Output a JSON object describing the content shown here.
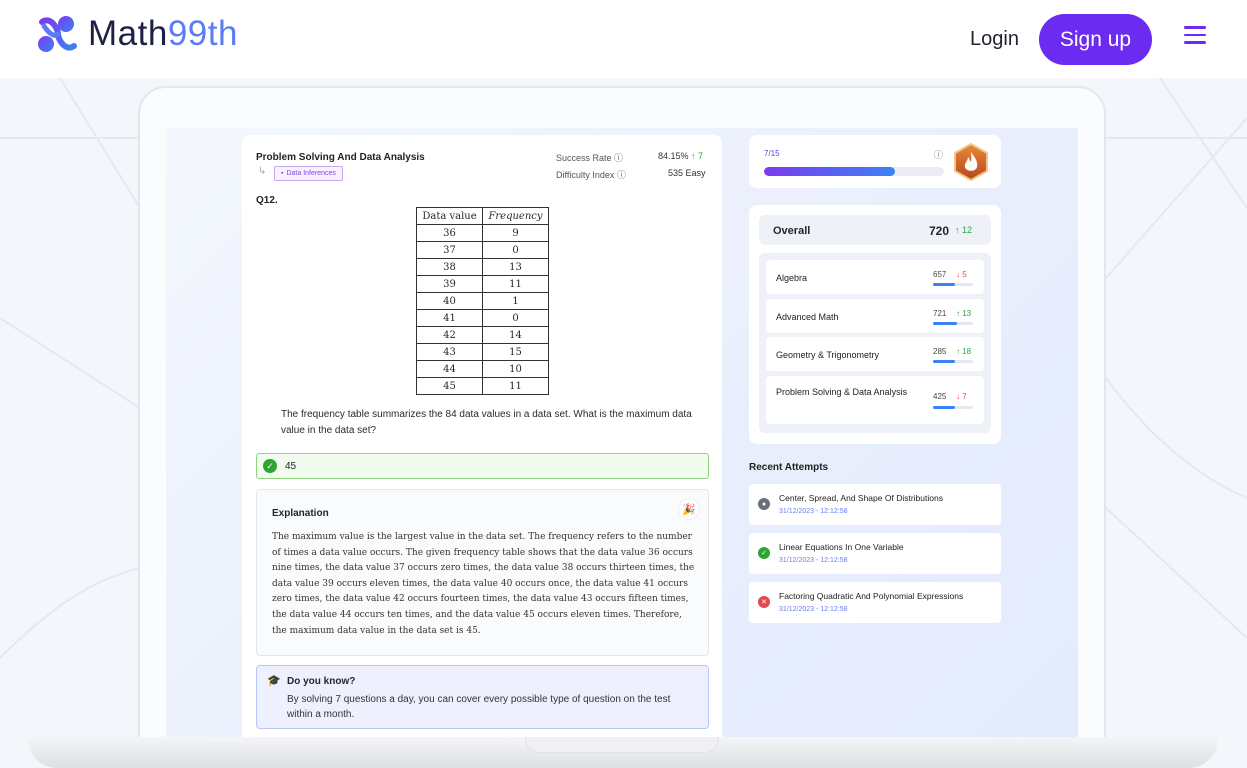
{
  "header": {
    "logo_text_main": "Math",
    "logo_text_accent": "99th",
    "login_label": "Login",
    "signup_label": "Sign up",
    "brand_color": "#6b2bf0"
  },
  "question": {
    "subject": "Problem Solving And Data Analysis",
    "tag": "Data Inferences",
    "success_rate_label": "Success Rate",
    "success_rate_value": "84.15%",
    "success_rate_delta": "↑ 7",
    "difficulty_label": "Difficulty Index",
    "difficulty_value": "535 Easy",
    "number": "Q12.",
    "table_headers": [
      "Data value",
      "Frequency"
    ],
    "table_rows": [
      [
        "36",
        "9"
      ],
      [
        "37",
        "0"
      ],
      [
        "38",
        "13"
      ],
      [
        "39",
        "11"
      ],
      [
        "40",
        "1"
      ],
      [
        "41",
        "0"
      ],
      [
        "42",
        "14"
      ],
      [
        "43",
        "15"
      ],
      [
        "44",
        "10"
      ],
      [
        "45",
        "11"
      ]
    ],
    "text": "The frequency table summarizes the 84 data values in a data set. What is the maximum data value in the data set?",
    "answer": "45",
    "explanation_title": "Explanation",
    "explanation_body": "The maximum value is the largest value in the data set. The frequency refers to the number of times a data value occurs. The given frequency table shows that the data value 36 occurs nine times, the data value 37 occurs zero times, the data value 38 occurs thirteen times, the data value 39 occurs eleven times, the data value 40 occurs once, the data value 41 occurs zero times, the data value 42 occurs fourteen times, the data value 43 occurs fifteen times, the data value 44 occurs ten times, and the data value 45 occurs eleven times. Therefore, the maximum data value in the data set is 45.",
    "know_title": "Do you know?",
    "know_body": "By solving 7 questions a day, you can cover every possible type of question on the test within a month."
  },
  "progress": {
    "label": "7/15",
    "fraction": 0.73
  },
  "scores": {
    "overall_label": "Overall",
    "overall_value": "720",
    "overall_delta": "↑ 12",
    "subjects": [
      {
        "name": "Algebra",
        "score": "657",
        "delta": "↓ 5",
        "trend": "down",
        "level": 0.55
      },
      {
        "name": "Advanced Math",
        "score": "721",
        "delta": "↑ 13",
        "trend": "up",
        "level": 0.6
      },
      {
        "name": "Geometry & Trigonometry",
        "score": "285",
        "delta": "↑ 18",
        "trend": "up",
        "level": 0.55
      },
      {
        "name": "Problem Solving & Data Analysis",
        "score": "425",
        "delta": "↓ 7",
        "trend": "down",
        "level": 0.55
      }
    ]
  },
  "recent": {
    "title": "Recent Attempts",
    "items": [
      {
        "name": "Center, Spread, And Shape Of Distributions",
        "date": "31/12/2023 - 12:12:58",
        "status": "pending",
        "color": "#6b6f76"
      },
      {
        "name": "Linear Equations In One Variable",
        "date": "31/12/2023 - 12:12:58",
        "status": "correct",
        "color": "#2ea52e"
      },
      {
        "name": "Factoring Quadratic And Polynomial Expressions",
        "date": "31/12/2023 - 12:12:58",
        "status": "incorrect",
        "color": "#e04b4b"
      }
    ]
  }
}
